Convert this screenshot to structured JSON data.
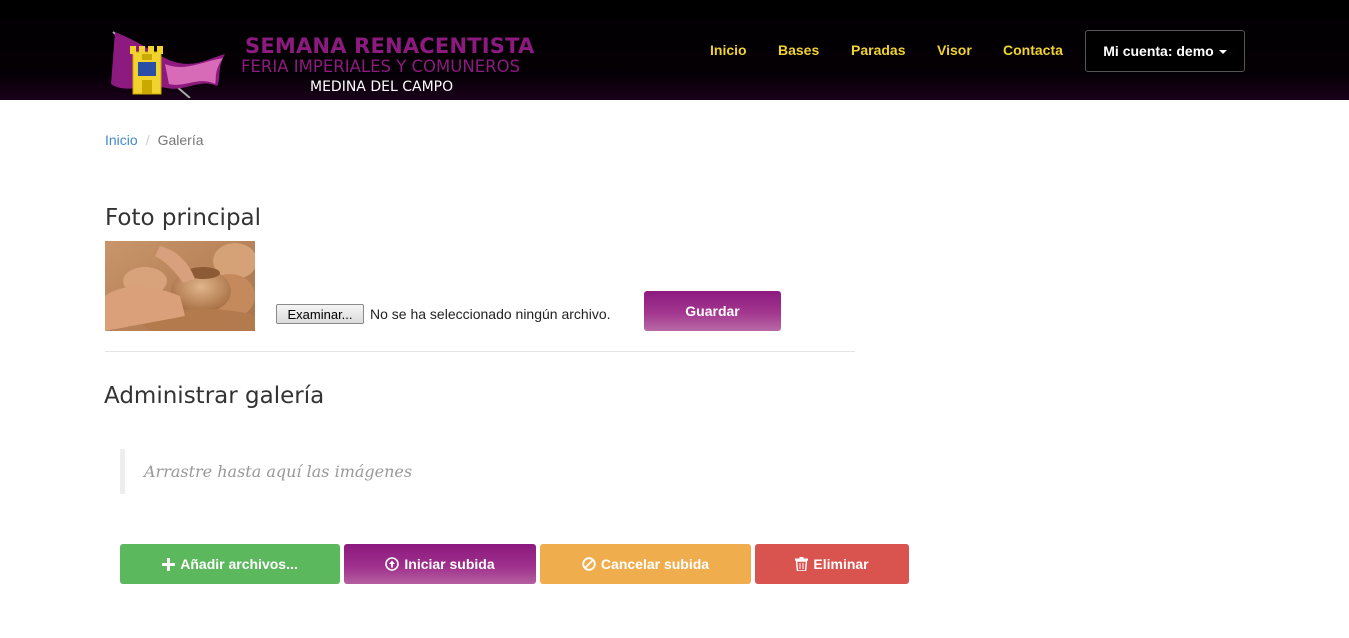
{
  "colors": {
    "brand_purple": "#8c1a7f",
    "logo_pink": "#d86bb8",
    "nav_yellow": "#f1d32f",
    "success": "#5cb85c",
    "warning": "#f0ad4e",
    "danger": "#d9534f",
    "link": "#428bca"
  },
  "header": {
    "logo": {
      "line1": "SEMANA RENACENTISTA",
      "line2": "FERIA IMPERIALES Y COMUNEROS",
      "line3": "MEDINA DEL CAMPO",
      "icon": "castle-flag-logo"
    },
    "nav": [
      "Inicio",
      "Bases",
      "Paradas",
      "Visor",
      "Contacta"
    ],
    "account_label": "Mi cuenta: demo"
  },
  "breadcrumb": {
    "home": "Inicio",
    "separator": "/",
    "current": "Galería"
  },
  "main_photo": {
    "title": "Foto principal",
    "image": "pottery-wheel-photo",
    "file_button": "Examinar...",
    "file_status": "No se ha seleccionado ningún archivo.",
    "save_label": "Guardar"
  },
  "gallery": {
    "title": "Administrar galería",
    "dropzone_text": "Arrastre hasta aquí las imágenes",
    "buttons": {
      "add": {
        "label": "Añadir archivos...",
        "icon": "plus-icon"
      },
      "start": {
        "label": "Iniciar subida",
        "icon": "circle-arrow-up-icon"
      },
      "cancel": {
        "label": "Cancelar subida",
        "icon": "ban-circle-icon"
      },
      "delete": {
        "label": "Eliminar",
        "icon": "trash-icon"
      }
    }
  }
}
